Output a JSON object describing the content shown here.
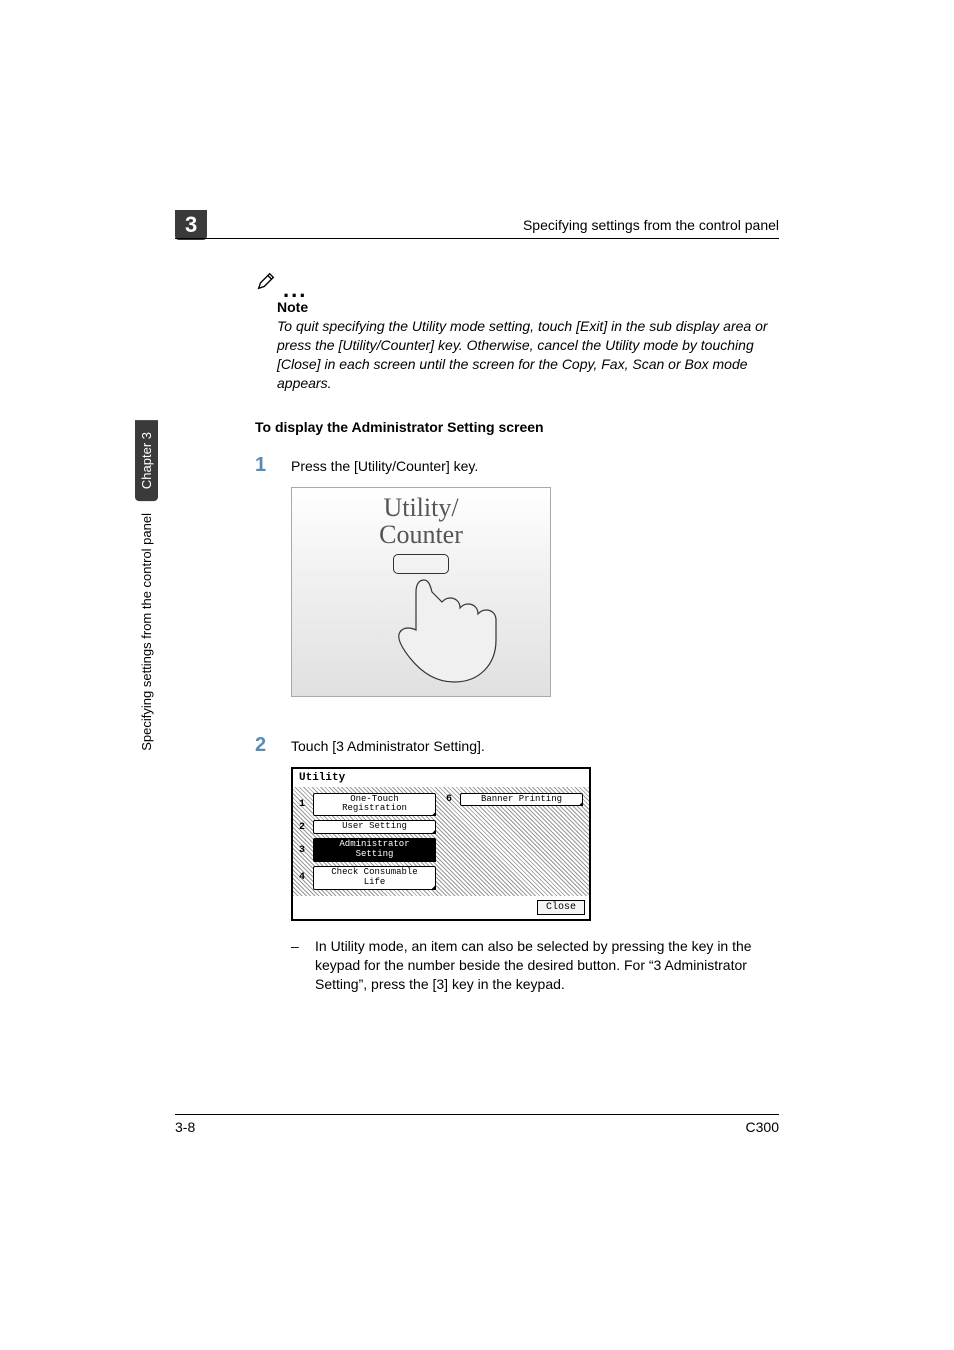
{
  "sideTab": {
    "chapter": "Chapter 3",
    "title": "Specifying settings from the control panel"
  },
  "header": {
    "chapterNum": "3",
    "title": "Specifying settings from the control panel"
  },
  "note": {
    "label": "Note",
    "body": "To quit specifying the Utility mode setting, touch [Exit] in the sub display area or press the [Utility/Counter] key. Otherwise, cancel the Utility mode by touching [Close] in each screen until the screen for the Copy, Fax, Scan or Box mode appears."
  },
  "sectionHeading": "To display the Administrator Setting screen",
  "steps": [
    {
      "num": "1",
      "text": "Press the [Utility/Counter] key."
    },
    {
      "num": "2",
      "text": "Touch [3 Administrator Setting]."
    }
  ],
  "figure1": {
    "line1": "Utility/",
    "line2": "Counter"
  },
  "figure2": {
    "title": "Utility",
    "left": [
      {
        "num": "1",
        "label": "One-Touch Registration",
        "selected": false
      },
      {
        "num": "2",
        "label": "User Setting",
        "selected": false
      },
      {
        "num": "3",
        "label": "Administrator Setting",
        "selected": true
      },
      {
        "num": "4",
        "label": "Check Consumable Life",
        "selected": false
      }
    ],
    "right": [
      {
        "num": "6",
        "label": "Banner Printing",
        "selected": false
      }
    ],
    "close": "Close"
  },
  "subNote": "In Utility mode, an item can also be selected by pressing the key in the keypad for the number beside the desired button. For “3 Administrator Setting”, press the [3] key in the keypad.",
  "footer": {
    "left": "3-8",
    "right": "C300"
  }
}
